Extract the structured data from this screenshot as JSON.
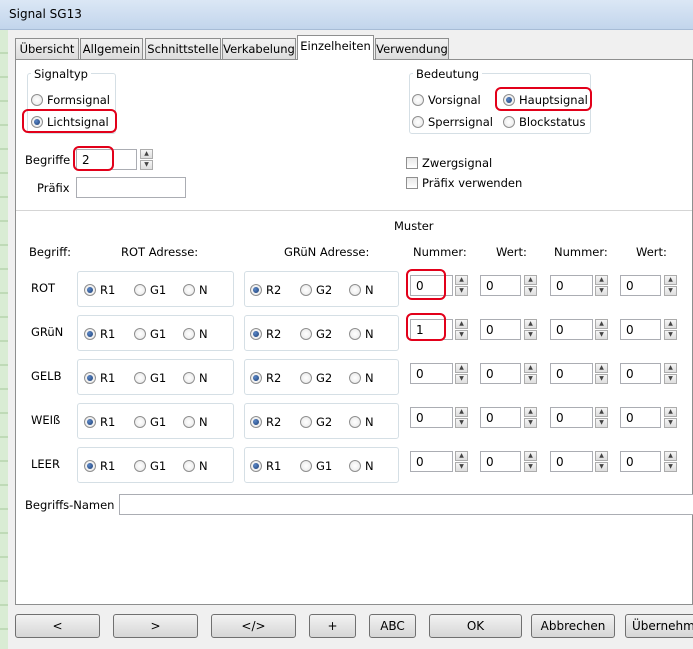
{
  "window": {
    "title": "Signal SG13"
  },
  "tabs": [
    "Übersicht",
    "Allgemein",
    "Schnittstelle",
    "Verkabelung",
    "Einzelheiten",
    "Verwendung"
  ],
  "active_tab": "Einzelheiten",
  "signaltyp": {
    "label": "Signaltyp",
    "options": [
      "Formsignal",
      "Lichtsignal"
    ],
    "selected": "Lichtsignal"
  },
  "bedeutung": {
    "label": "Bedeutung",
    "options": [
      "Vorsignal",
      "Hauptsignal",
      "Sperrsignal",
      "Blockstatus"
    ],
    "selected": "Hauptsignal"
  },
  "begriffe": {
    "label": "Begriffe",
    "value": "2"
  },
  "praefix": {
    "label": "Präfix",
    "value": ""
  },
  "checkboxes": {
    "zwergsignal": "Zwergsignal",
    "praefix_verwenden": "Präfix verwenden"
  },
  "muster": {
    "title": "Muster",
    "headers": {
      "begriff": "Begriff:",
      "rot_adresse": "ROT Adresse:",
      "gruen_adresse": "GRüN Adresse:",
      "nummer1": "Nummer:",
      "wert1": "Wert:",
      "nummer2": "Nummer:",
      "wert2": "Wert:"
    },
    "rows": [
      {
        "name": "ROT",
        "rot_opts": [
          "R1",
          "G1",
          "N"
        ],
        "rot_sel": "R1",
        "gruen_opts": [
          "R2",
          "G2",
          "N"
        ],
        "gruen_sel": "R2",
        "nummer1": "0",
        "wert1": "0",
        "nummer2": "0",
        "wert2": "0"
      },
      {
        "name": "GRüN",
        "rot_opts": [
          "R1",
          "G1",
          "N"
        ],
        "rot_sel": "R1",
        "gruen_opts": [
          "R2",
          "G2",
          "N"
        ],
        "gruen_sel": "R2",
        "nummer1": "1",
        "wert1": "0",
        "nummer2": "0",
        "wert2": "0"
      },
      {
        "name": "GELB",
        "rot_opts": [
          "R1",
          "G1",
          "N"
        ],
        "rot_sel": "R1",
        "gruen_opts": [
          "R2",
          "G2",
          "N"
        ],
        "gruen_sel": "R2",
        "nummer1": "0",
        "wert1": "0",
        "nummer2": "0",
        "wert2": "0"
      },
      {
        "name": "WEIß",
        "rot_opts": [
          "R1",
          "G1",
          "N"
        ],
        "rot_sel": "R1",
        "gruen_opts": [
          "R2",
          "G2",
          "N"
        ],
        "gruen_sel": "R2",
        "nummer1": "0",
        "wert1": "0",
        "nummer2": "0",
        "wert2": "0"
      },
      {
        "name": "LEER",
        "rot_opts": [
          "R1",
          "G1",
          "N"
        ],
        "rot_sel": "R1",
        "gruen_opts": [
          "R1",
          "G1",
          "N"
        ],
        "gruen_sel": "R1",
        "nummer1": "0",
        "wert1": "0",
        "nummer2": "0",
        "wert2": "0"
      }
    ]
  },
  "begriffs_namen": {
    "label": "Begriffs-Namen",
    "value": ""
  },
  "buttons": {
    "prev": "<",
    "next": ">",
    "code": "</>",
    "add": "+",
    "abc": "ABC",
    "ok": "OK",
    "abbrechen": "Abbrechen",
    "uebernehmen": "Übernehmen"
  },
  "colors": {
    "highlight": "#e2001a",
    "radio_selected": "#1c3f75"
  },
  "icons": {
    "spin": "spinner-up-down-icon"
  }
}
